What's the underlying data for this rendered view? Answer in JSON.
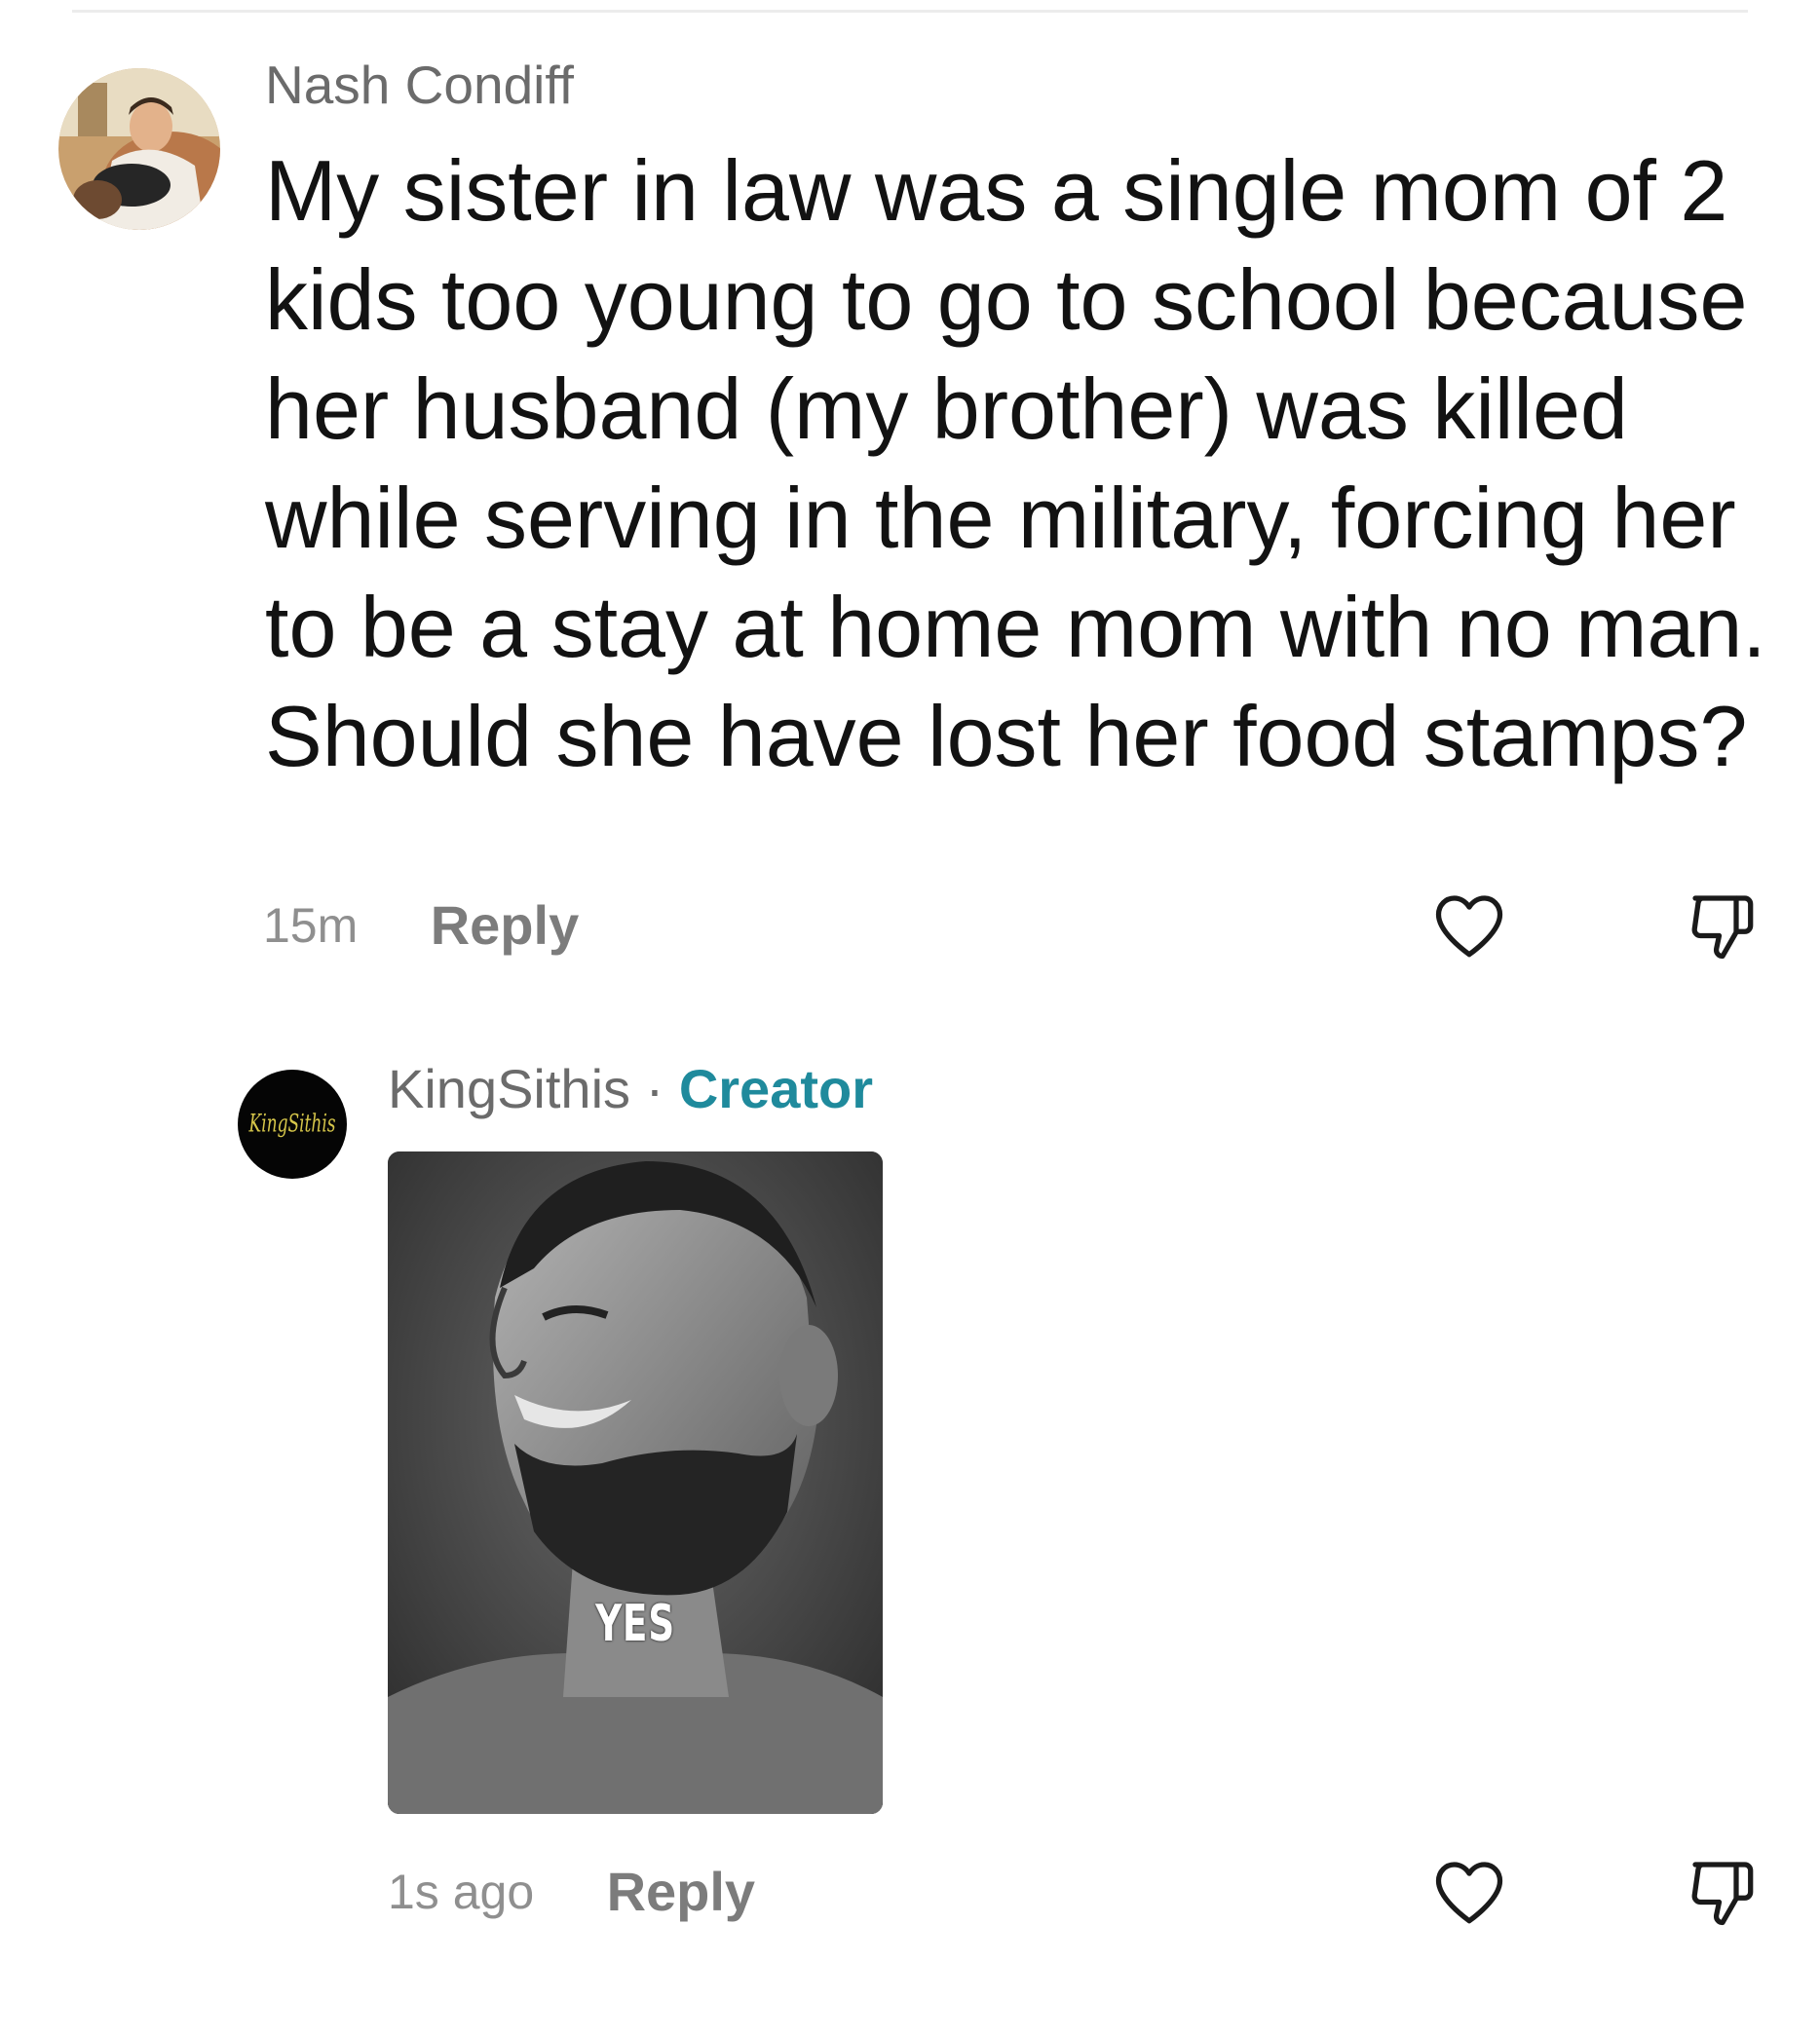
{
  "comments": [
    {
      "username": "Nash Condiff",
      "text": "My sister in law was a single mom of 2 kids too young to go to school because her husband (my brother) was killed while serving in the military, forcing her to be a stay at home mom with no man. Should she have lost her food stamps?",
      "time": "15m",
      "reply_label": "Reply",
      "avatar_icon": "user-photo-avatar",
      "like_icon": "heart-outline-icon",
      "dislike_icon": "thumbs-down-outline-icon"
    },
    {
      "username": "KingSithis",
      "separator": "·",
      "badge": "Creator",
      "avatar_text": "KingSithis",
      "image_caption": "YES",
      "time": "1s ago",
      "reply_label": "Reply",
      "like_icon": "heart-outline-icon",
      "dislike_icon": "thumbs-down-outline-icon"
    }
  ],
  "colors": {
    "username": "#6b6b6b",
    "body_text": "#121212",
    "meta_text": "#8f8f8f",
    "creator_badge": "#1f8a9c",
    "icon_stroke": "#1a1a1a"
  }
}
